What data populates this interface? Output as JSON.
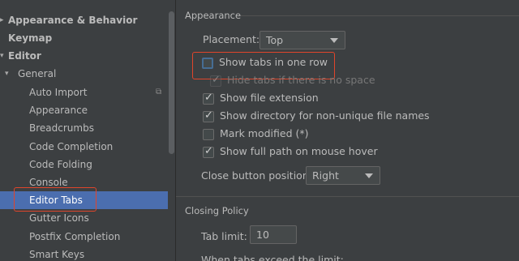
{
  "sidebar": {
    "items": [
      {
        "label": "Appearance & Behavior",
        "arrow": "▸",
        "level": 0,
        "bold": true
      },
      {
        "label": "Keymap",
        "arrow": "",
        "level": 0,
        "bold": true
      },
      {
        "label": "Editor",
        "arrow": "▾",
        "level": 0,
        "bold": true
      },
      {
        "label": "General",
        "arrow": "▾",
        "level": 1,
        "bold": false
      },
      {
        "label": "Auto Import",
        "arrow": "",
        "level": 2,
        "bold": false,
        "icon": "copy-icon"
      },
      {
        "label": "Appearance",
        "arrow": "",
        "level": 2,
        "bold": false
      },
      {
        "label": "Breadcrumbs",
        "arrow": "",
        "level": 2,
        "bold": false
      },
      {
        "label": "Code Completion",
        "arrow": "",
        "level": 2,
        "bold": false
      },
      {
        "label": "Code Folding",
        "arrow": "",
        "level": 2,
        "bold": false
      },
      {
        "label": "Console",
        "arrow": "",
        "level": 2,
        "bold": false
      },
      {
        "label": "Editor Tabs",
        "arrow": "",
        "level": 2,
        "bold": false,
        "selected": true
      },
      {
        "label": "Gutter Icons",
        "arrow": "",
        "level": 2,
        "bold": false
      },
      {
        "label": "Postfix Completion",
        "arrow": "",
        "level": 2,
        "bold": false
      },
      {
        "label": "Smart Keys",
        "arrow": "",
        "level": 2,
        "bold": false
      }
    ]
  },
  "appearance": {
    "title": "Appearance",
    "placement_label": "Placement:",
    "placement_value": "Top",
    "options": [
      {
        "label": "Show tabs in one row",
        "checked": false,
        "enabled": true,
        "focused": true
      },
      {
        "label": "Hide tabs if there is no space",
        "checked": true,
        "enabled": false
      },
      {
        "label": "Show file extension",
        "checked": true,
        "enabled": true
      },
      {
        "label": "Show directory for non-unique file names",
        "checked": true,
        "enabled": true
      },
      {
        "label": "Mark modified (*)",
        "checked": false,
        "enabled": true
      },
      {
        "label": "Show full path on mouse hover",
        "checked": true,
        "enabled": true
      }
    ],
    "close_button_label": "Close button position:",
    "close_button_value": "Right"
  },
  "closing": {
    "title": "Closing Policy",
    "tab_limit_label": "Tab limit:",
    "tab_limit_value": "10",
    "exceed_label": "When tabs exceed the limit:"
  },
  "colors": {
    "background": "#3c3f41",
    "selection": "#4b6eaf",
    "highlight_box": "#e0452b",
    "text": "#bbbbbb"
  }
}
